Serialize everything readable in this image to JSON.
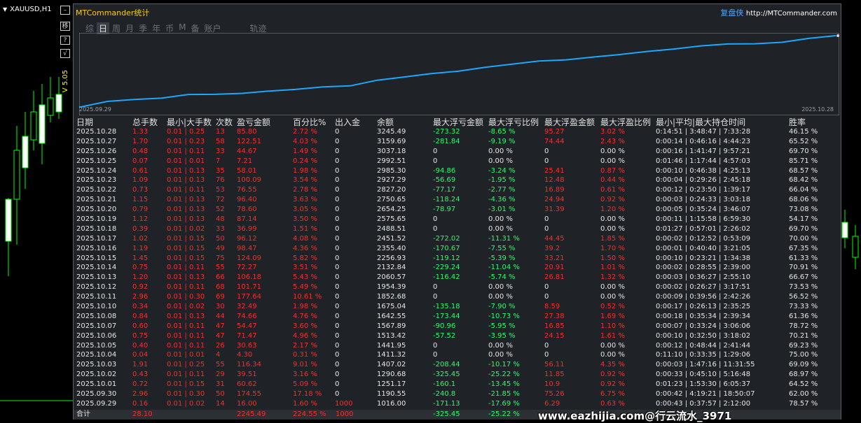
{
  "chart_window": {
    "title": "XAUUSD,H1",
    "vertical_label": "V 5.05",
    "controls": [
      {
        "label": "",
        "icon": "minimize-icon"
      },
      {
        "label": "移",
        "icon": "move-icon"
      },
      {
        "label": "?",
        "icon": "help-icon"
      },
      {
        "label": "√",
        "icon": "check-icon"
      }
    ]
  },
  "panel": {
    "title": "MTCommander统计",
    "brand": "复盘侠",
    "url": "http://MTCommander.com",
    "tabs": [
      "综",
      "日",
      "周",
      "月",
      "季",
      "年",
      "币",
      "M",
      "备",
      "账户",
      "轨迹"
    ],
    "active_tab": "日"
  },
  "colors": {
    "loss": "#ff2a2a",
    "gain": "#27ff6a",
    "equity_line": "#1ea7ff",
    "panel_bg": "#1f2226"
  },
  "chart_data": {
    "type": "line",
    "x_start_label": "2025.09.29",
    "x_end_label": "2025.10.28",
    "series": [
      {
        "values": [
          1016.0,
          1190.55,
          1251.17,
          1290.68,
          1407.02,
          1411.32,
          1441.95,
          1513.42,
          1567.89,
          1642.55,
          1675.04,
          1852.68,
          1954.39,
          2060.57,
          2132.84,
          2256.93,
          2355.4,
          2451.52,
          2488.51,
          2575.65,
          2654.25,
          2750.65,
          2827.2,
          2927.29,
          2985.3,
          2992.51,
          3037.18,
          3159.69,
          3245.49
        ]
      }
    ]
  },
  "table": {
    "headers": [
      "日期",
      "总手数",
      "最小|大手数",
      "次数",
      "盈亏金额",
      "百分比%",
      "出入金",
      "余额",
      "最大浮亏金额",
      "最大浮亏比例",
      "最大浮盈金额",
      "最大浮盈比例",
      "最小|平均|最大持仓时间",
      "胜率"
    ],
    "rows": [
      [
        "2025.10.28",
        "1.33",
        "0.01 | 0.25",
        "13",
        "85.80",
        "2.72 %",
        "0",
        "3245.49",
        "-273.32",
        "-8.65 %",
        "95.27",
        "3.02 %",
        "0:14:51 | 3:48:47 | 7:33:28",
        "46.15 %"
      ],
      [
        "2025.10.27",
        "1.70",
        "0.01 | 0.23",
        "58",
        "122.51",
        "4.03 %",
        "0",
        "3159.69",
        "-281.84",
        "-9.19 %",
        "74.44",
        "2.43 %",
        "0:00:14 | 0:46:16 | 4:44:23",
        "65.52 %"
      ],
      [
        "2025.10.26",
        "0.48",
        "0.01 | 0.11",
        "33",
        "44.67",
        "1.49 %",
        "0",
        "3037.18",
        "0",
        "0.00 %",
        "0",
        "0.00 %",
        "0:00:16 | 1:41:47 | 9:57:21",
        "69.70 %"
      ],
      [
        "2025.10.25",
        "0.07",
        "0.01 | 0.01",
        "7",
        "7.21",
        "0.24 %",
        "0",
        "2992.51",
        "0",
        "0.00 %",
        "0",
        "0.00 %",
        "0:01:46 | 1:17:44 | 4:57:03",
        "85.71 %"
      ],
      [
        "2025.10.24",
        "0.61",
        "0.01 | 0.13",
        "35",
        "58.01",
        "1.98 %",
        "0",
        "2985.30",
        "-94.86",
        "-3.24 %",
        "25.41",
        "0.87 %",
        "0:00:10 | 0:46:38 | 4:25:13",
        "68.57 %"
      ],
      [
        "2025.10.23",
        "1.09",
        "0.01 | 0.13",
        "76",
        "100.09",
        "3.54 %",
        "0",
        "2927.29",
        "-56.69",
        "-1.95 %",
        "12.48",
        "0.44 %",
        "0:00:04 | 0:29:26 | 2:45:18",
        "68.42 %"
      ],
      [
        "2025.10.22",
        "0.73",
        "0.01 | 0.11",
        "53",
        "76.55",
        "2.78 %",
        "0",
        "2827.20",
        "-77.17",
        "-2.77 %",
        "16.89",
        "0.61 %",
        "0:00:12 | 0:23:50 | 1:39:17",
        "66.04 %"
      ],
      [
        "2025.10.21",
        "1.15",
        "0.01 | 0.13",
        "72",
        "96.40",
        "3.63 %",
        "0",
        "2750.65",
        "-118.24",
        "-4.36 %",
        "24.94",
        "0.92 %",
        "0:00:03 | 0:24:33 | 3:03:18",
        "68.06 %"
      ],
      [
        "2025.10.20",
        "0.79",
        "0.01 | 0.13",
        "52",
        "78.60",
        "3.05 %",
        "0",
        "2654.25",
        "-78.97",
        "-3.01 %",
        "31.39",
        "1.20 %",
        "0:00:05 | 0:35:24 | 3:46:07",
        "73.08 %"
      ],
      [
        "2025.10.19",
        "1.12",
        "0.01 | 0.13",
        "48",
        "87.14",
        "3.50 %",
        "0",
        "2575.65",
        "0",
        "0.00 %",
        "0",
        "0.00 %",
        "0:00:11 | 1:15:58 | 6:59:30",
        "54.17 %"
      ],
      [
        "2025.10.18",
        "0.39",
        "0.01 | 0.02",
        "33",
        "36.99",
        "1.51 %",
        "0",
        "2488.51",
        "0",
        "0.00 %",
        "0",
        "0.00 %",
        "0:01:27 | 0:57:01 | 2:26:02",
        "69.70 %"
      ],
      [
        "2025.10.17",
        "1.02",
        "0.01 | 0.15",
        "50",
        "96.12",
        "4.08 %",
        "0",
        "2451.52",
        "-272.02",
        "-11.31 %",
        "44.45",
        "1.85 %",
        "0:00:02 | 0:12:52 | 0:53:09",
        "70.00 %"
      ],
      [
        "2025.10.16",
        "1.19",
        "0.01 | 0.15",
        "49",
        "98.47",
        "4.36 %",
        "0",
        "2355.40",
        "-170.67",
        "-7.55 %",
        "39.2",
        "1.70 %",
        "0:00:01 | 0:40:40 | 3:21:05",
        "67.35 %"
      ],
      [
        "2025.10.15",
        "1.45",
        "0.01 | 0.15",
        "75",
        "124.09",
        "5.82 %",
        "0",
        "2256.93",
        "-119.12",
        "-5.39 %",
        "33.21",
        "1.50 %",
        "0:00:10 | 0:23:21 | 1:34:38",
        "61.33 %"
      ],
      [
        "2025.10.14",
        "0.75",
        "0.01 | 0.11",
        "55",
        "72.27",
        "3.51 %",
        "0",
        "2132.84",
        "-229.24",
        "-11.04 %",
        "20.91",
        "1.01 %",
        "0:00:02 | 0:28:55 | 2:39:00",
        "70.91 %"
      ],
      [
        "2025.10.13",
        "1.20",
        "0.01 | 0.13",
        "66",
        "106.18",
        "5.43 %",
        "0",
        "2060.57",
        "-116.42",
        "-5.74 %",
        "26.81",
        "1.32 %",
        "0:00:03 | 0:36:27 | 2:55:10",
        "66.67 %"
      ],
      [
        "2025.10.12",
        "0.92",
        "0.01 | 0.11",
        "68",
        "101.71",
        "5.49 %",
        "0",
        "1954.39",
        "0",
        "0.00 %",
        "0",
        "0.00 %",
        "0:00:02 | 0:26:27 | 3:17:51",
        "73.53 %"
      ],
      [
        "2025.10.11",
        "2.96",
        "0.01 | 0.30",
        "69",
        "177.64",
        "10.61 %",
        "0",
        "1852.68",
        "0",
        "0.00 %",
        "0",
        "0.00 %",
        "0:00:09 | 0:39:56 | 2:42:26",
        "56.52 %"
      ],
      [
        "2025.10.10",
        "0.34",
        "0.01 | 0.02",
        "30",
        "32.49",
        "1.98 %",
        "0",
        "1675.04",
        "-135.18",
        "-7.90 %",
        "8.59",
        "0.52 %",
        "0:00:17 | 0:26:13 | 2:35:25",
        "73.33 %"
      ],
      [
        "2025.10.08",
        "0.84",
        "0.01 | 0.13",
        "44",
        "74.66",
        "4.76 %",
        "0",
        "1642.55",
        "-173.44",
        "-10.73 %",
        "27.38",
        "1.69 %",
        "0:00:18 | 0:35:34 | 2:39:34",
        "61.36 %"
      ],
      [
        "2025.10.07",
        "0.60",
        "0.01 | 0.11",
        "47",
        "54.47",
        "3.60 %",
        "0",
        "1567.89",
        "-90.96",
        "-5.95 %",
        "16.85",
        "1.10 %",
        "0:00:07 | 0:33:24 | 3:06:06",
        "78.72 %"
      ],
      [
        "2025.10.06",
        "0.75",
        "0.01 | 0.11",
        "47",
        "71.47",
        "4.96 %",
        "0",
        "1513.42",
        "-57.52",
        "-3.95 %",
        "24.15",
        "1.61 %",
        "0:00:10 | 0:32:50 | 3:18:02",
        "70.21 %"
      ],
      [
        "2025.10.05",
        "0.40",
        "0.01 | 0.11",
        "26",
        "30.63",
        "2.17 %",
        "0",
        "1441.95",
        "0",
        "0.00 %",
        "0",
        "0.00 %",
        "0:00:12 | 0:48:44 | 2:41:44",
        "69.23 %"
      ],
      [
        "2025.10.04",
        "0.04",
        "0.01 | 0.01",
        "4",
        "4.30",
        "0.31 %",
        "0",
        "1411.32",
        "0",
        "0.00 %",
        "0",
        "0.00 %",
        "0:11:10 | 0:33:35 | 1:29:06",
        "75.00 %"
      ],
      [
        "2025.10.03",
        "1.91",
        "0.01 | 0.25",
        "55",
        "116.34",
        "9.01 %",
        "0",
        "1407.02",
        "-208.44",
        "-10.17 %",
        "56.11",
        "4.35 %",
        "0:00:03 | 1:47:16 | 11:31:55",
        "69.09 %"
      ],
      [
        "2025.10.02",
        "0.43",
        "0.01 | 0.11",
        "29",
        "39.51",
        "3.16 %",
        "0",
        "1290.68",
        "-325.45",
        "-25.22 %",
        "11.85",
        "0.92 %",
        "0:00:33 | 0:45:10 | 5:16:48",
        "68.97 %"
      ],
      [
        "2025.10.01",
        "0.72",
        "0.01 | 0.15",
        "31",
        "60.62",
        "5.09 %",
        "0",
        "1251.17",
        "-160.1",
        "-13.45 %",
        "10.9",
        "0.92 %",
        "0:01:23 | 1:53:30 | 6:05:37",
        "64.52 %"
      ],
      [
        "2025.09.30",
        "2.96",
        "0.01 | 0.30",
        "50",
        "174.55",
        "17.18 %",
        "0",
        "1190.55",
        "-240.8",
        "-21.85 %",
        "75.26",
        "6.75 %",
        "0:00:42 | 4:19:21 | 18:50:07",
        "62.00 %"
      ],
      [
        "2025.09.29",
        "0.16",
        "0.01 | 0.02",
        "14",
        "16.00",
        "1.60 %",
        "1000",
        "1016.00",
        "-171.13",
        "-17.69 %",
        "6.29",
        "0.63 %",
        "0:00:43 | 0:37:57 | 2:12:00",
        "78.57 %"
      ]
    ],
    "total": {
      "label": "合计",
      "lots": "28.10",
      "profit": "2245.49",
      "percent": "224.55 %",
      "deposit": "1000",
      "max_float_loss": "-325.45",
      "max_float_loss_pct": "-25.22 %"
    }
  },
  "watermark": "www.eazhijia.com@行云流水_3971"
}
